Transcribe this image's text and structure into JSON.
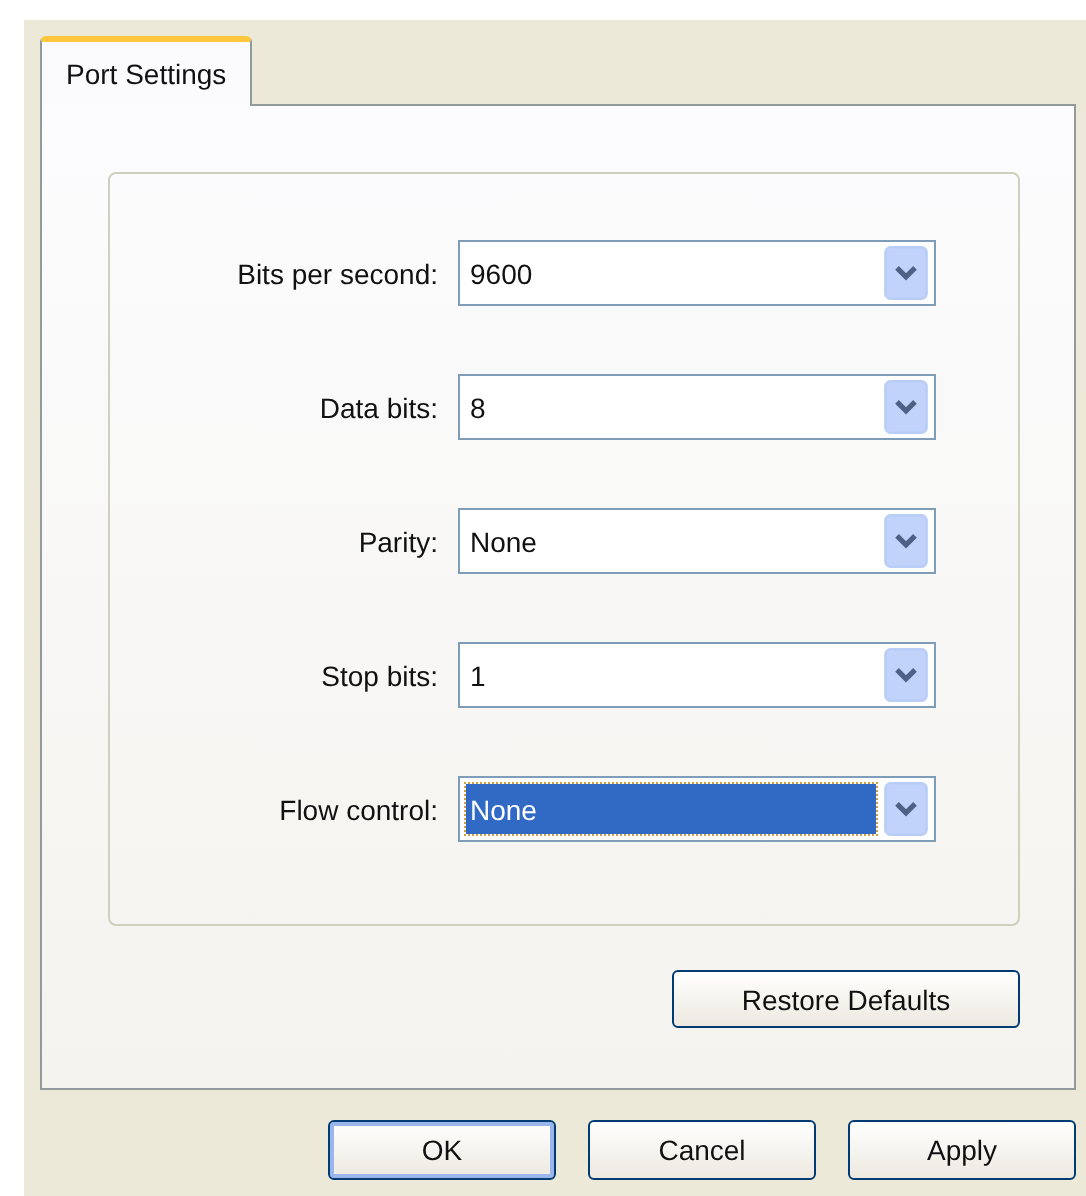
{
  "tabs": [
    {
      "label": "Port Settings",
      "selected": true
    }
  ],
  "fields": [
    {
      "label": "Bits per second:",
      "value": "9600",
      "focused": false
    },
    {
      "label": "Data bits:",
      "value": "8",
      "focused": false
    },
    {
      "label": "Parity:",
      "value": "None",
      "focused": false
    },
    {
      "label": "Stop bits:",
      "value": "1",
      "focused": false
    },
    {
      "label": "Flow control:",
      "value": "None",
      "focused": true
    }
  ],
  "restore_button": "Restore Defaults",
  "buttons": [
    {
      "label": "OK",
      "default": true
    },
    {
      "label": "Cancel",
      "default": false
    },
    {
      "label": "Apply",
      "default": false
    }
  ]
}
